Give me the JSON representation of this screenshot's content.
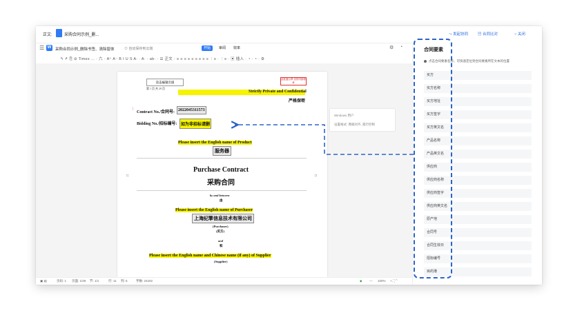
{
  "topbar": {
    "label": "正文:",
    "file_name": "采购合同示例_删...",
    "initiate_sign": "发起协同",
    "contract_compare": "合同比对",
    "close": "关闭"
  },
  "toolbar": {
    "menu_icon": "menu-icon",
    "doc_title": "采购合同示例_删除书签、清除窗体",
    "autosave": "自动保存到云端",
    "tabs": [
      "开始",
      "审阅",
      "效率"
    ],
    "active_tab": "开始",
    "format_row": "↰ ↱ ⎘ ⊘   Times ... ·  六 ·  A⁺  A⁻   B  I  U  S  A· ·  A· ·  ab· ·   ☰ 正文 ·  ≡  ≡  ≡  ≡  ≡  ≡  ≡  ≡  ≡  ⋮≡ ·  ⋮≡ ·   ▣ 插入 ·  ◔ ·  ◔ ·  ⚙"
  },
  "document": {
    "edit_area_label": "双击编辑页眉",
    "page_label": "第 1 页 共 29 页",
    "stamp_text": "此处盖公章 仅供内部参考",
    "strictly_private": "Strictly Private and Confidential",
    "strictly_private_cn": "严格保密",
    "contract_no_label": "Contract No./合同号:",
    "contract_no_value": "2022045311573",
    "bidding_no_label": "Bidding No./招标编号:",
    "bidding_no_value": "如为非招标请删",
    "product_prompt": "Please insert the English name of Product",
    "product_cn": "服务器",
    "title_en": "Purchase Contract",
    "title_cn": "采购合同",
    "by_and_between": "by and between",
    "by_and_between_cn": "由",
    "purchaser_prompt": "Please insert the English name of Purchaser",
    "purchaser_cn": "上海纪擎信息技术有限公司",
    "purchaser_role": "(Purchaser)",
    "purchaser_role_cn": "(买方)",
    "and": "and",
    "and_cn": "和",
    "supplier_prompt": "Please insert the English name and Chinese name (if any) of Supplier",
    "supplier_role": "(Supplier)"
  },
  "comment": {
    "author": "Windows 用户",
    "text": "设置格式: 两端对齐, 孤行控制"
  },
  "status": {
    "pages": "页码: 1",
    "page_count": "页面: 1/29",
    "section": "节: 1/1",
    "row": "行: 11",
    "col": "列: 5",
    "words": "字数: 24202",
    "zoom": "100%"
  },
  "panel": {
    "title": "合同要素",
    "hint": "点击合同要素名称，可快速定位到合同要素所在文本的位置",
    "items": [
      "买方",
      "买方名称",
      "买方地址",
      "买方签字",
      "买方英文名",
      "产品名称",
      "产品英文名",
      "供应商",
      "供应商名称",
      "供应商签字",
      "供应商英文名",
      "原产地",
      "合同号",
      "合同生效日",
      "招标编号",
      "目的港"
    ]
  },
  "colors": {
    "accent": "#2f7bf5",
    "highlight": "#f6f300",
    "annotation": "#2b63c6"
  }
}
